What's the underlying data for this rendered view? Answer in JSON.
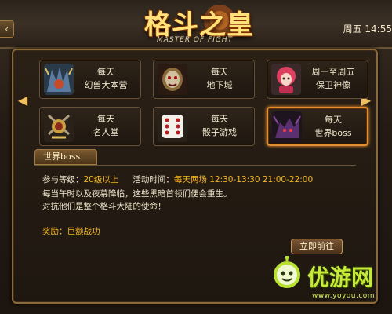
{
  "header": {
    "back_symbol": "‹",
    "logo_title": "格斗之皇",
    "logo_subtitle": "MASTER OF FIGHT",
    "clock": "周五 14:55"
  },
  "navigation": {
    "left_arrow": "◀",
    "right_arrow": "▶"
  },
  "cards": [
    {
      "line1": "每天",
      "line2": "幻兽大本营",
      "icon": "beast-camp-icon",
      "selected": false
    },
    {
      "line1": "每天",
      "line2": "地下城",
      "icon": "dungeon-icon",
      "selected": false
    },
    {
      "line1": "周一至周五",
      "line2": "保卫神像",
      "icon": "guard-statue-icon",
      "selected": false
    },
    {
      "line1": "每天",
      "line2": "名人堂",
      "icon": "hall-of-fame-icon",
      "selected": false
    },
    {
      "line1": "每天",
      "line2": "骰子游戏",
      "icon": "dice-icon",
      "selected": false
    },
    {
      "line1": "每天",
      "line2": "世界boss",
      "icon": "world-boss-icon",
      "selected": true
    }
  ],
  "detail": {
    "tab": "世界boss",
    "level_label": "参与等级：",
    "level_value": "20级以上",
    "time_label": "活动时间：",
    "time_value": "每天两场 12:30-13:30  21:00-22:00",
    "desc1": "每当午时以及夜幕降临，这些黑暗首领们便会重生。",
    "desc2": "对抗他们是整个格斗大陆的使命！",
    "reward_label": "奖励：",
    "reward_value": "巨额战功",
    "go_button": "立即前往"
  },
  "watermark": {
    "text": "优游网",
    "url": "www.yoyou.com"
  },
  "colors": {
    "accent": "#f6b820",
    "selected_border": "#e09030",
    "frame": "#8a6a3a"
  }
}
